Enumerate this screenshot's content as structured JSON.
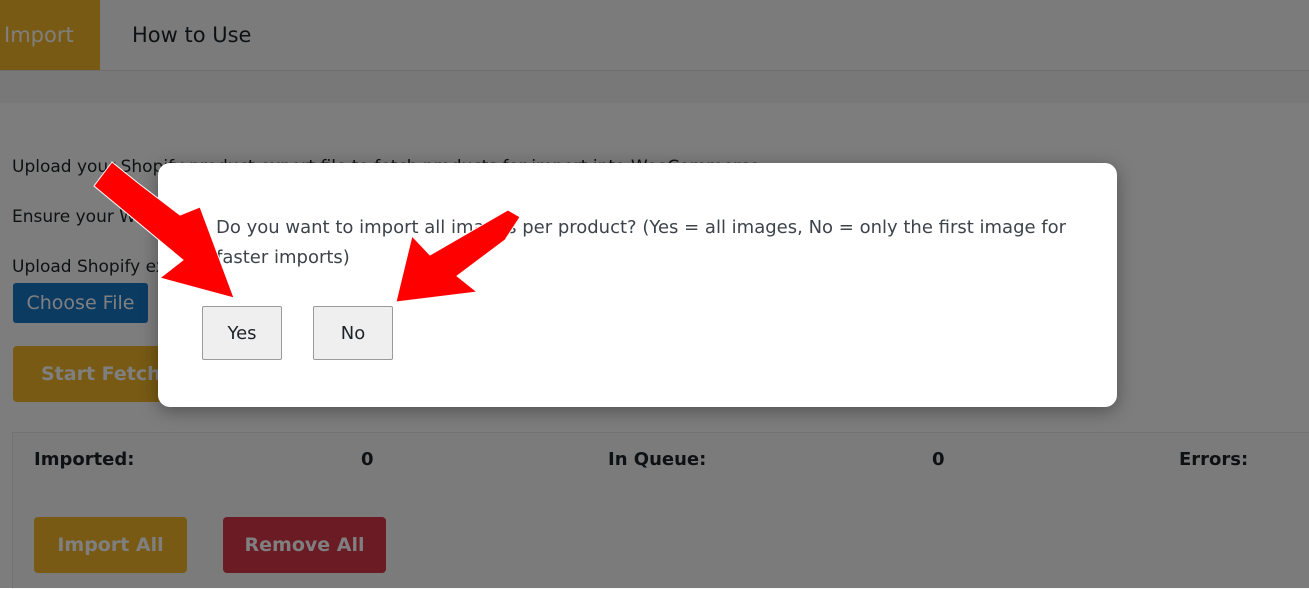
{
  "tabs": [
    {
      "label": "Import",
      "active": true
    },
    {
      "label": "How to Use",
      "active": false
    }
  ],
  "page": {
    "line1": "Upload your Shopify product export file to fetch products for import into WooCommerce",
    "line2": "Ensure your WooCommerce store is set up",
    "line3": "Upload Shopify export",
    "choose_file_label": "Choose File",
    "start_fetch_label": "Start Fetch"
  },
  "stats": {
    "imported_label": "Imported:",
    "imported_value": "0",
    "queue_label": "In Queue:",
    "queue_value": "0",
    "errors_label": "Errors:"
  },
  "actions": {
    "import_all_label": "Import All",
    "remove_all_label": "Remove All"
  },
  "dialog": {
    "message": "Do you want to import all images per product? (Yes = all images, No = only the first image for faster imports)",
    "yes_label": "Yes",
    "no_label": "No"
  },
  "colors": {
    "accent": "#f0b429",
    "file_button": "#1976c5",
    "danger": "#d63649",
    "annotation_arrow": "#ff0000"
  }
}
